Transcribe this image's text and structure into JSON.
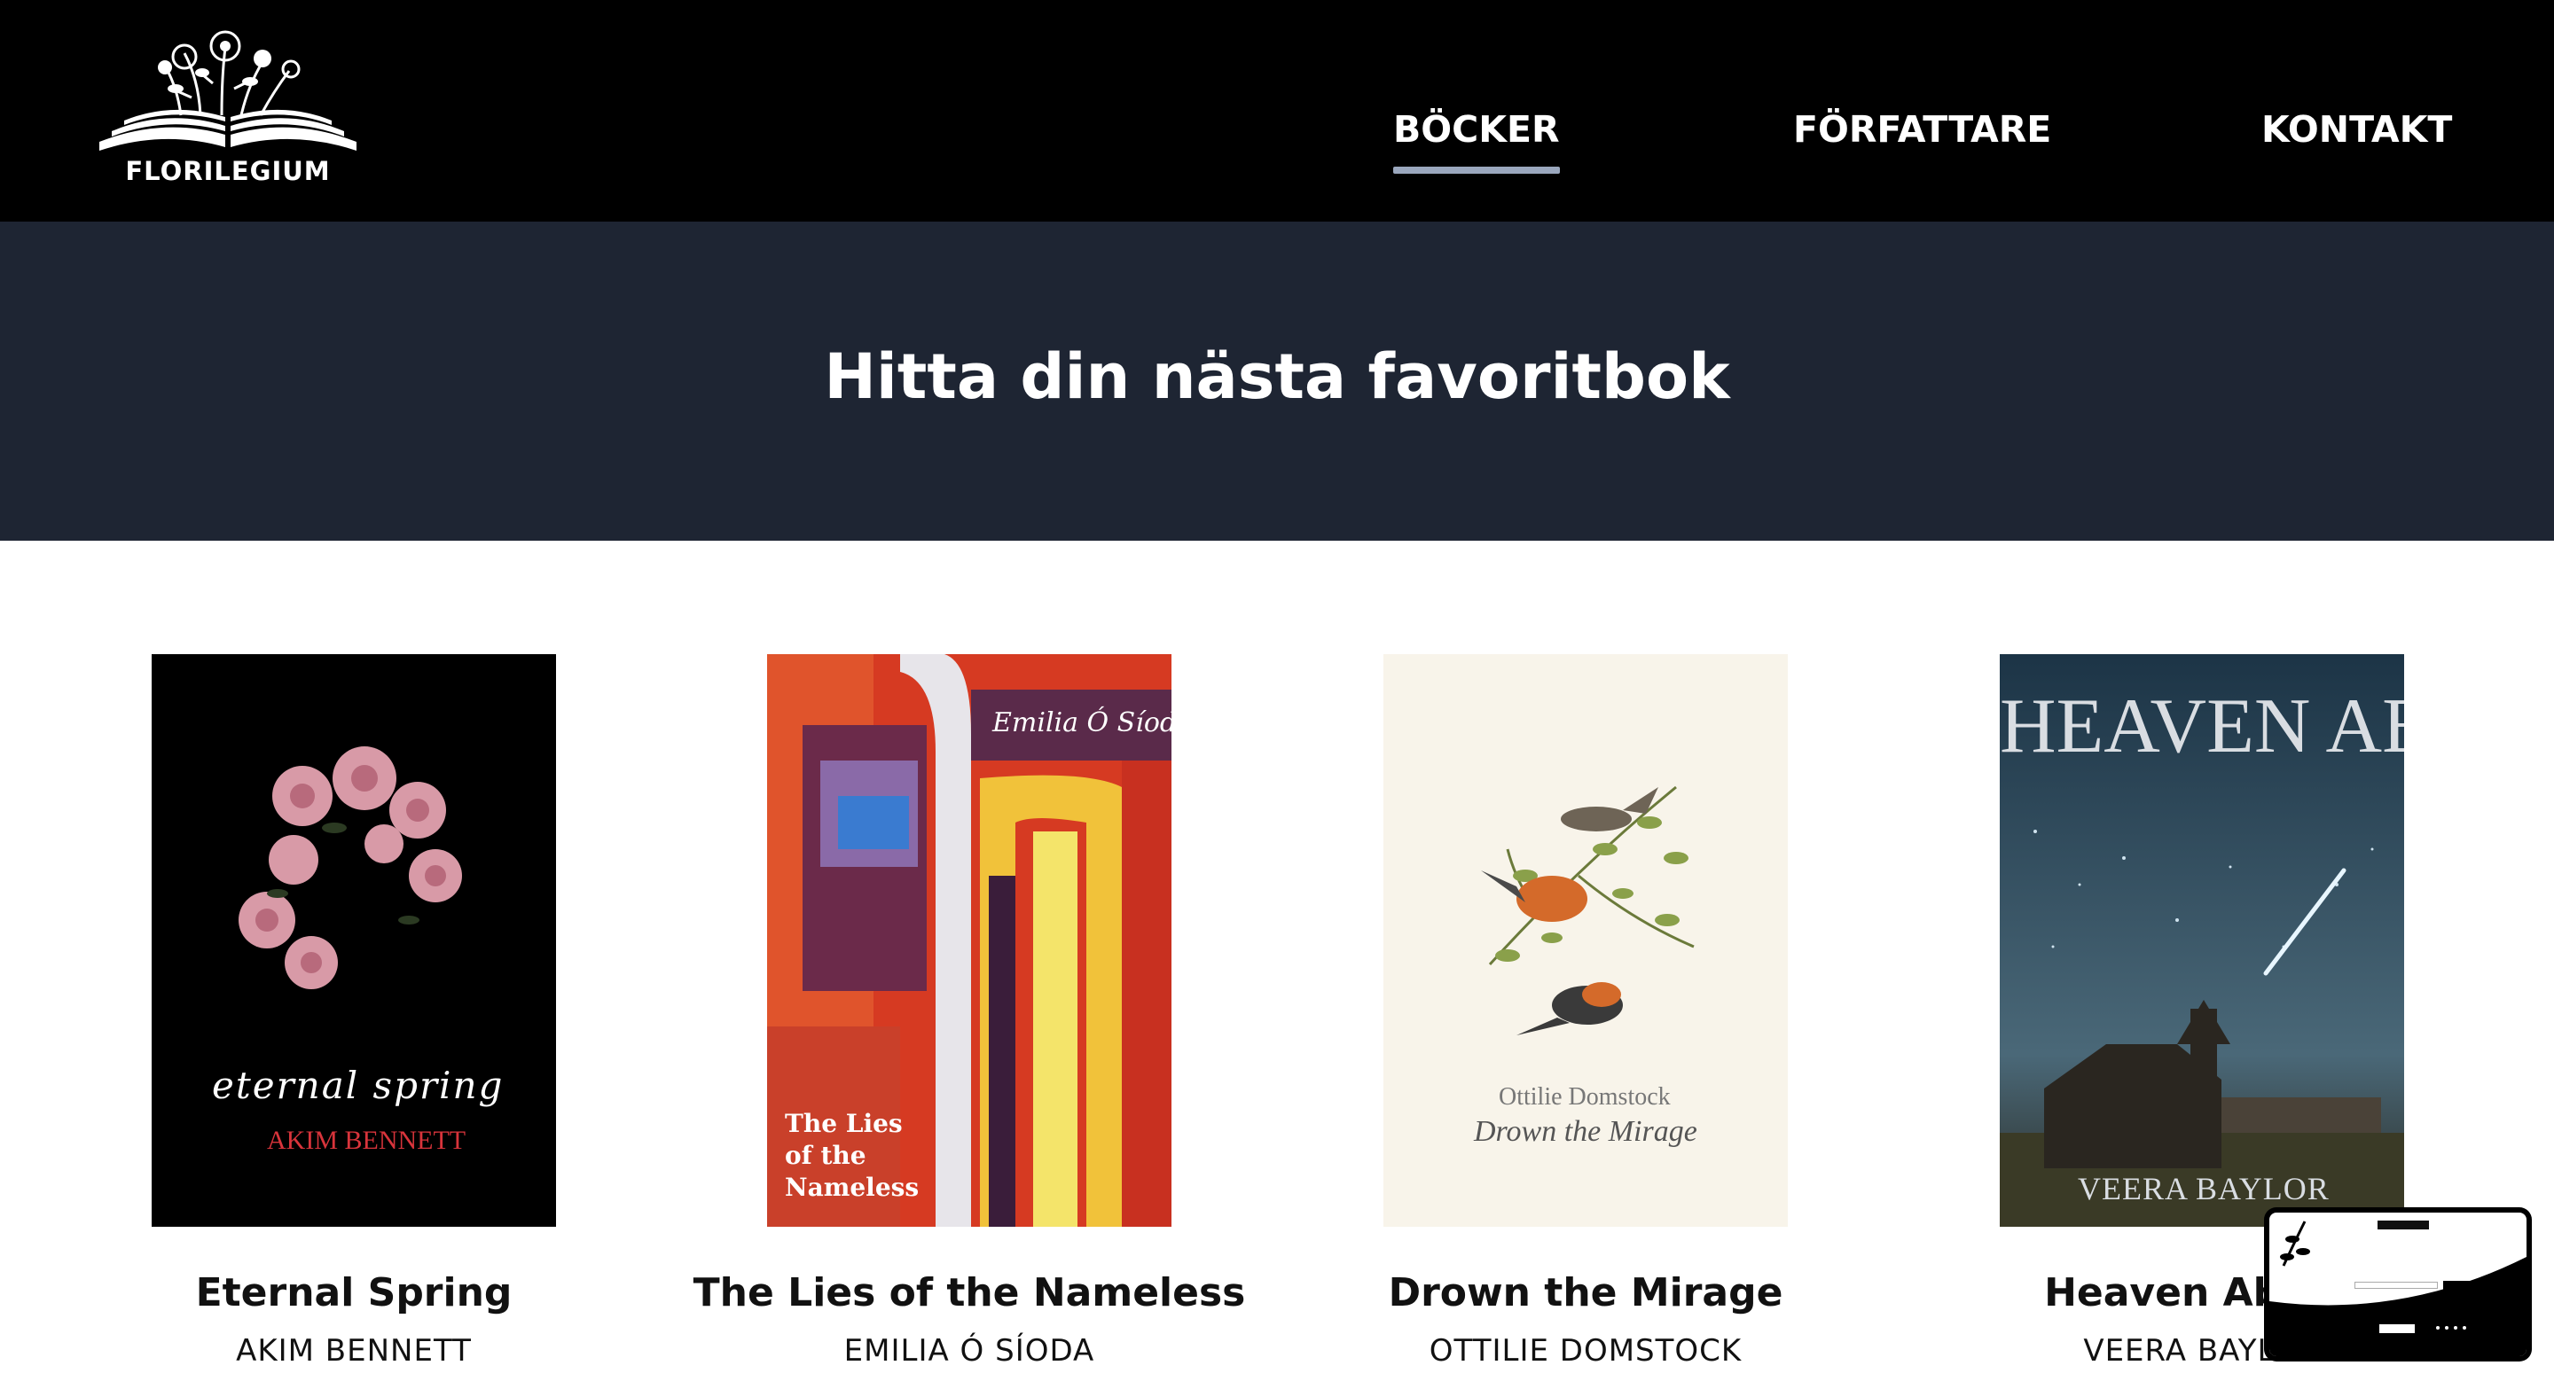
{
  "header": {
    "logo_text": "FLORILEGIUM",
    "nav": [
      {
        "label": "BÖCKER",
        "active": true
      },
      {
        "label": "FÖRFATTARE",
        "active": false
      },
      {
        "label": "KONTAKT",
        "active": false
      }
    ]
  },
  "hero": {
    "title": "Hitta din nästa favoritbok"
  },
  "books": [
    {
      "title": "Eternal Spring",
      "author": "AKIM BENNETT",
      "cover_title": "eternal spring",
      "cover_author": "AKIM BENNETT"
    },
    {
      "title": "The Lies of the Nameless",
      "author": "EMILIA Ó SÍODA",
      "cover_title": "The Lies of the Nameless",
      "cover_author": "Emilia Ó Síoda"
    },
    {
      "title": "Drown the Mirage",
      "author": "OTTILIE DOMSTOCK",
      "cover_title": "Drown the Mirage",
      "cover_author": "Ottilie Domstock"
    },
    {
      "title": "Heaven Above",
      "author": "VEERA BAYLOR",
      "cover_title": "HEAVEN ABOVE",
      "cover_author": "VEERA BAYLOR"
    }
  ],
  "colors": {
    "header_bg": "#000000",
    "hero_bg": "#1e2533",
    "nav_underline": "#9aa7bd",
    "page_bg": "#ffffff"
  },
  "icons": [
    "florilegium-logo",
    "newsletter-preview-thumbnail"
  ]
}
